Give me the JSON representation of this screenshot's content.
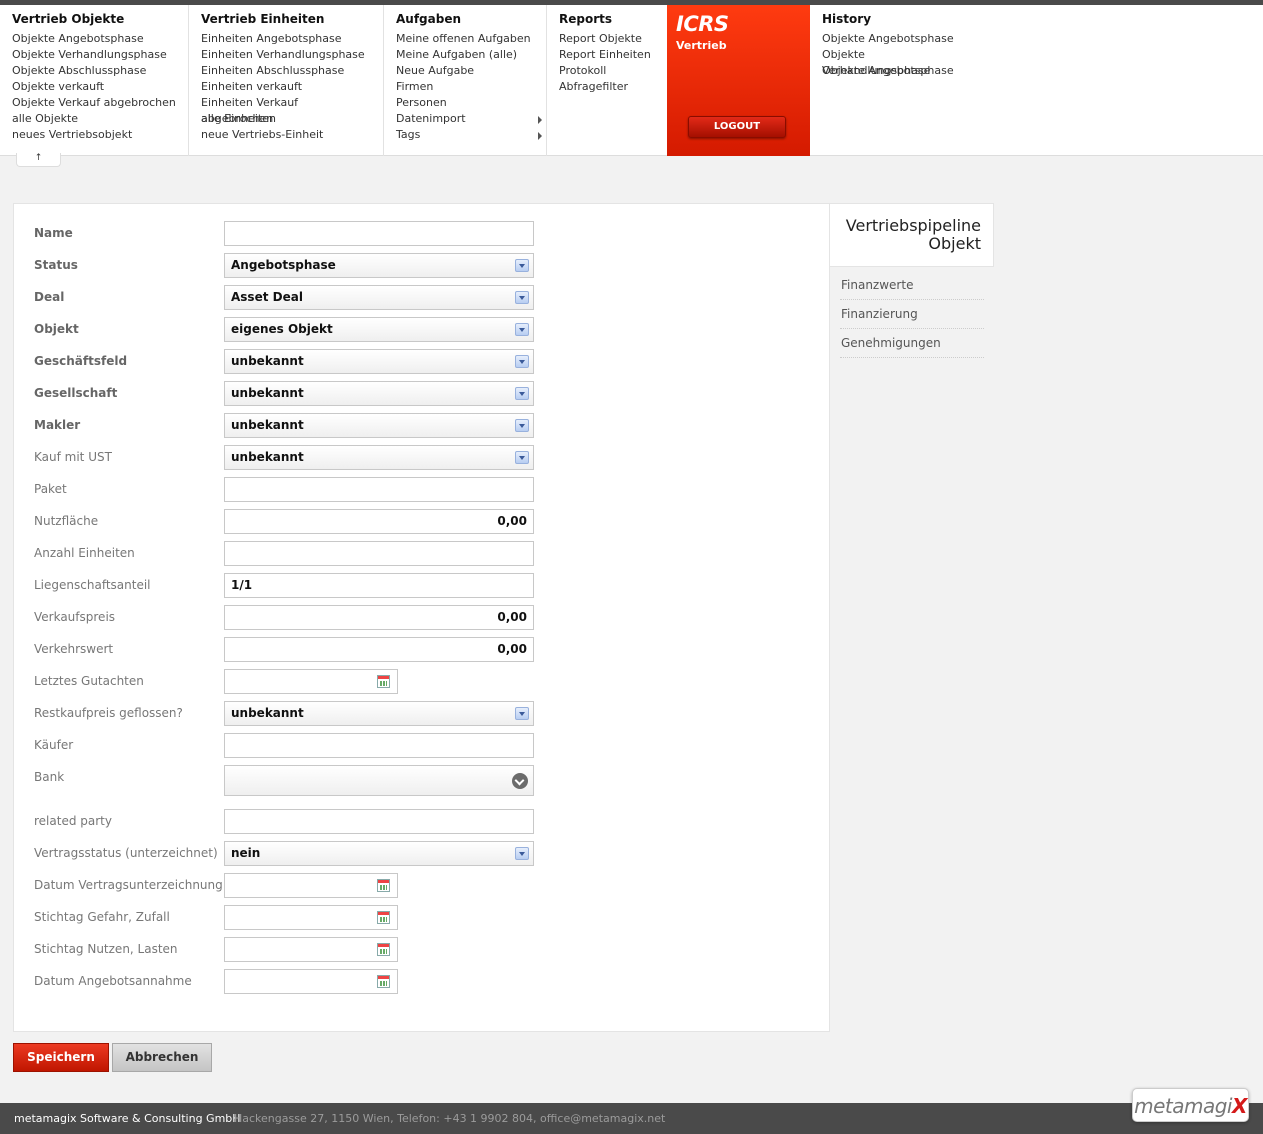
{
  "menu": {
    "vertrieb_objekte": {
      "title": "Vertrieb Objekte",
      "items": [
        "Objekte Angebotsphase",
        "Objekte Verhandlungsphase",
        "Objekte Abschlussphase",
        "Objekte verkauft",
        "Objekte Verkauf abgebrochen",
        "alle Objekte",
        "neues Vertriebsobjekt"
      ]
    },
    "vertrieb_einheiten": {
      "title": "Vertrieb Einheiten",
      "items": [
        "Einheiten Angebotsphase",
        "Einheiten Verhandlungsphase",
        "Einheiten Abschlussphase",
        "Einheiten verkauft",
        "Einheiten Verkauf abgebrochen",
        "alle Einheiten",
        "neue Vertriebs-Einheit"
      ]
    },
    "aufgaben": {
      "title": "Aufgaben",
      "items": [
        "Meine offenen Aufgaben",
        "Meine Aufgaben (alle)",
        "Neue Aufgabe",
        "Firmen",
        "Personen",
        "Datenimport",
        "Tags"
      ]
    },
    "reports": {
      "title": "Reports",
      "items": [
        "Report Objekte",
        "Report Einheiten",
        "Protokoll",
        "Abfragefilter"
      ]
    },
    "icrs": {
      "brand": "ICRS",
      "sub": "Vertrieb",
      "logout": "LOGOUT"
    },
    "history": {
      "title": "History",
      "items": [
        "Objekte Angebotsphase",
        "Objekte Verhandlungsphase",
        "Objekte Angebotsphase"
      ]
    },
    "collapse_icon": "↑"
  },
  "form": {
    "name": {
      "label": "Name",
      "value": ""
    },
    "status": {
      "label": "Status",
      "value": "Angebotsphase"
    },
    "deal": {
      "label": "Deal",
      "value": "Asset Deal"
    },
    "objekt": {
      "label": "Objekt",
      "value": "eigenes Objekt"
    },
    "geschaeftsfeld": {
      "label": "Geschäftsfeld",
      "value": "unbekannt"
    },
    "gesellschaft": {
      "label": "Gesellschaft",
      "value": "unbekannt"
    },
    "makler": {
      "label": "Makler",
      "value": "unbekannt"
    },
    "kauf_mit_ust": {
      "label": "Kauf mit UST",
      "value": "unbekannt"
    },
    "paket": {
      "label": "Paket",
      "value": ""
    },
    "nutzflaeche": {
      "label": "Nutzfläche",
      "value": "0,00"
    },
    "anzahl_einheiten": {
      "label": "Anzahl Einheiten",
      "value": ""
    },
    "liegenschaftsanteil": {
      "label": "Liegenschaftsanteil",
      "value": "1/1"
    },
    "verkaufspreis": {
      "label": "Verkaufspreis",
      "value": "0,00"
    },
    "verkehrswert": {
      "label": "Verkehrswert",
      "value": "0,00"
    },
    "letztes_gutachten": {
      "label": "Letztes Gutachten",
      "value": ""
    },
    "restkaufpreis": {
      "label": "Restkaufpreis geflossen?",
      "value": "unbekannt"
    },
    "kaeufer": {
      "label": "Käufer",
      "value": ""
    },
    "bank": {
      "label": "Bank",
      "value": ""
    },
    "related_party": {
      "label": "related party",
      "value": ""
    },
    "vertragsstatus": {
      "label": "Vertragsstatus (unterzeichnet)",
      "value": "nein"
    },
    "datum_vertragsunterzeichnung": {
      "label": "Datum Vertragsunterzeichnung",
      "value": ""
    },
    "stichtag_gefahr": {
      "label": "Stichtag Gefahr, Zufall",
      "value": ""
    },
    "stichtag_nutzen": {
      "label": "Stichtag Nutzen, Lasten",
      "value": ""
    },
    "datum_angebotsannahme": {
      "label": "Datum Angebotsannahme",
      "value": ""
    }
  },
  "side": {
    "title_line1": "Vertriebspipeline",
    "title_line2": "Objekt",
    "links": [
      "Finanzwerte",
      "Finanzierung",
      "Genehmigungen"
    ]
  },
  "buttons": {
    "save": "Speichern",
    "cancel": "Abbrechen"
  },
  "footer": {
    "company": "metamagix Software & Consulting GmbH",
    "address": "Hackengasse 27, 1150 Wien, Telefon: +43 1 9902 804, office@metamagix.net",
    "logo_text": "metamagi",
    "logo_accent": "X"
  },
  "colors": {
    "accent_red": "#e32a18",
    "footer_bg": "#4a4a4a"
  }
}
